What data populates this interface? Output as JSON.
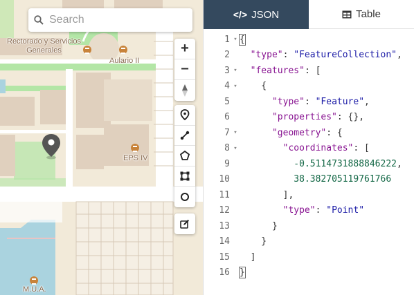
{
  "search": {
    "placeholder": "Search"
  },
  "map": {
    "labels": {
      "rectorado": "Rectorado y Servicios\nGenerales",
      "aulario": "Aulario II",
      "eps": "EPS IV",
      "mua": "M.U.A."
    },
    "controls": {
      "zoom_in": "+",
      "zoom_out": "−"
    },
    "colors": {
      "water": "#aad3df",
      "grass": "#b3e6a6",
      "building": "#e0d0be",
      "road": "#ffffff",
      "land": "#f2ead9"
    }
  },
  "tabs": [
    {
      "label": "JSON",
      "active": true
    },
    {
      "label": "Table",
      "active": false
    }
  ],
  "editor": {
    "line_numbers": [
      "1",
      "2",
      "3",
      "4",
      "5",
      "6",
      "7",
      "8",
      "9",
      "10",
      "11",
      "12",
      "13",
      "14",
      "15",
      "16"
    ],
    "coordinates": [
      "-0.5114731888846222",
      "38.382705119761766"
    ],
    "type_collection": "\"FeatureCollection\"",
    "type_feature": "\"Feature\"",
    "type_point": "\"Point\""
  }
}
